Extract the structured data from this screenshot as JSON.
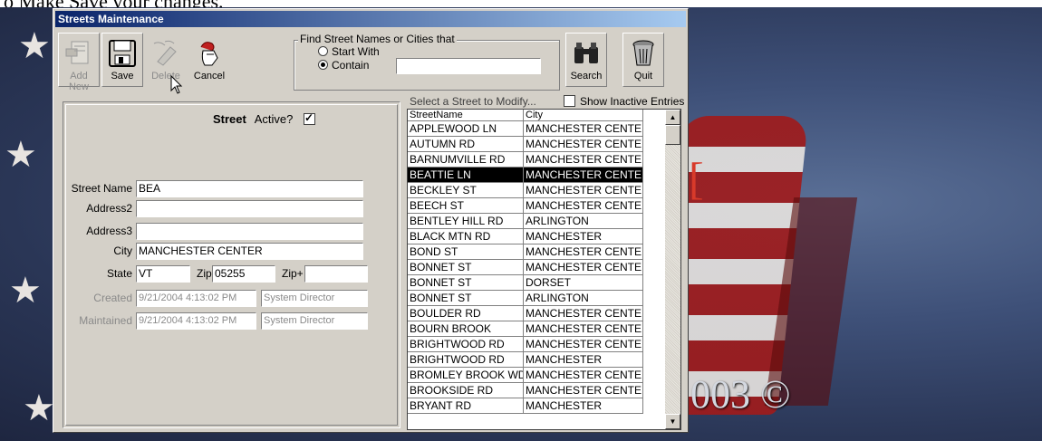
{
  "background": {
    "cut_text": "o Make Save your changes.",
    "copyright_text": "003 ©",
    "accent_colors": {
      "titlebar": "#0a246a",
      "selection": "#000000",
      "face": "#d4d0c8"
    }
  },
  "window": {
    "title": "Streets Maintenance"
  },
  "toolbar": {
    "add_new": "Add New",
    "save": "Save",
    "delete": "Delete",
    "cancel": "Cancel",
    "search": "Search",
    "quit": "Quit"
  },
  "find": {
    "legend": "Find Street Names or Cities that",
    "start_with": "Start With",
    "contain": "Contain",
    "selected": "contain",
    "value": ""
  },
  "form": {
    "header_title": "Street",
    "active_label": "Active?",
    "active": true,
    "street_name_label": "Street Name",
    "street_name": "BEA",
    "address2_label": "Address2",
    "address2": "",
    "address3_label": "Address3",
    "address3": "",
    "city_label": "City",
    "city": "MANCHESTER CENTER",
    "state_label": "State",
    "state": "VT",
    "zip_label": "Zip",
    "zip": "05255",
    "zipplus_label": "Zip+",
    "zipplus": "",
    "created_label": "Created",
    "created_date": "9/21/2004 4:13:02 PM",
    "created_by": "System Director",
    "maintained_label": "Maintained",
    "maintained_date": "9/21/2004 4:13:02 PM",
    "maintained_by": "System Director"
  },
  "list": {
    "caption": "Select a Street to Modify...",
    "show_inactive": "Show Inactive Entries",
    "show_inactive_checked": false,
    "columns": [
      "StreetName",
      "City"
    ],
    "selected_index": 3,
    "rows": [
      [
        "APPLEWOOD LN",
        "MANCHESTER CENTE"
      ],
      [
        "AUTUMN RD",
        "MANCHESTER CENTE"
      ],
      [
        "BARNUMVILLE RD",
        "MANCHESTER CENTE"
      ],
      [
        "BEATTIE LN",
        "MANCHESTER CENTE"
      ],
      [
        "BECKLEY ST",
        "MANCHESTER CENTE"
      ],
      [
        "BEECH ST",
        "MANCHESTER CENTE"
      ],
      [
        "BENTLEY HILL RD",
        "ARLINGTON"
      ],
      [
        "BLACK MTN RD",
        "MANCHESTER"
      ],
      [
        "BOND ST",
        "MANCHESTER CENTE"
      ],
      [
        "BONNET ST",
        "MANCHESTER CENTE"
      ],
      [
        "BONNET ST",
        "DORSET"
      ],
      [
        "BONNET ST",
        "ARLINGTON"
      ],
      [
        "BOULDER RD",
        "MANCHESTER CENTE"
      ],
      [
        "BOURN BROOK",
        "MANCHESTER CENTE"
      ],
      [
        "BRIGHTWOOD RD",
        "MANCHESTER CENTE"
      ],
      [
        "BRIGHTWOOD RD",
        "MANCHESTER"
      ],
      [
        "BROMLEY BROOK WD",
        "MANCHESTER CENTE"
      ],
      [
        "BROOKSIDE RD",
        "MANCHESTER CENTE"
      ],
      [
        "BRYANT RD",
        "MANCHESTER"
      ]
    ]
  }
}
